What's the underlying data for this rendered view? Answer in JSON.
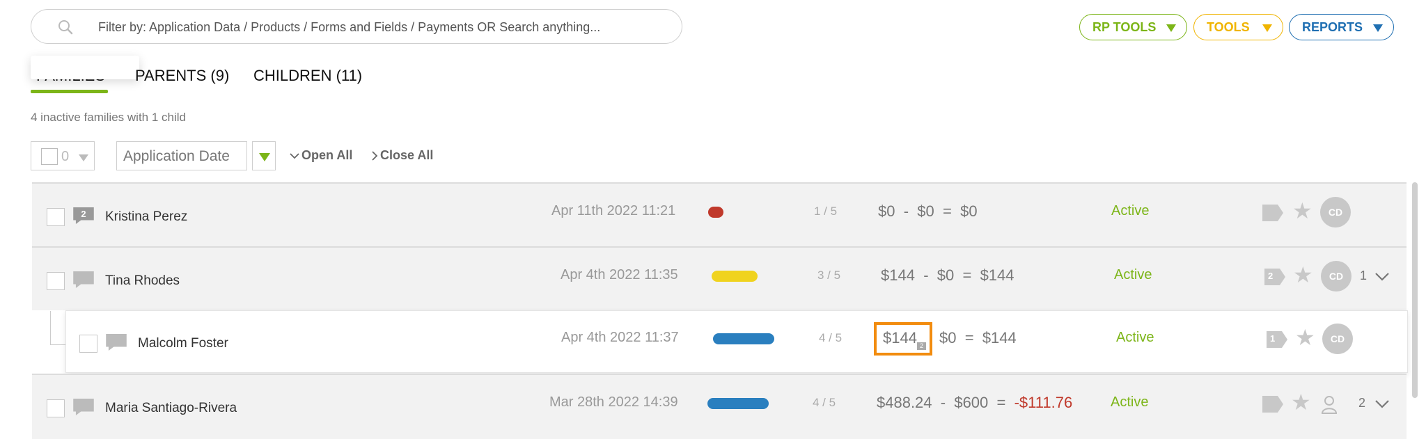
{
  "search": {
    "placeholder": "Filter by: Application Data / Products / Forms and Fields / Payments OR Search anything..."
  },
  "toolbar": {
    "rp_tools": "RP TOOLS",
    "tools": "TOOLS",
    "reports": "REPORTS"
  },
  "tabs": {
    "families": "FAMILIES",
    "parents": "PARENTS (9)",
    "children": "CHILDREN (11)"
  },
  "summary": "4 inactive families with 1 child",
  "filters": {
    "selected_count": "0",
    "sort_by": "Application Date",
    "open_all": "Open All",
    "close_all": "Close All"
  },
  "colors": {
    "accent_green": "#7cb518",
    "accent_yellow": "#f0b400",
    "accent_blue": "#1f6fb2",
    "highlight_orange": "#f28c0f",
    "negative_red": "#c0392b"
  },
  "rows": [
    {
      "name": "Kristina Perez",
      "message_count": "2",
      "date": "Apr 11th 2022 11:21",
      "progress": {
        "fraction": "1 / 5",
        "value": 0.2,
        "color": "#c0392b"
      },
      "charged": "$0",
      "paid": "$0",
      "balance": "$0",
      "status": "Active",
      "tag_count": "",
      "avatar": "CD",
      "child_count": ""
    },
    {
      "name": "Tina Rhodes",
      "message_count": "",
      "date": "Apr 4th 2022 11:35",
      "progress": {
        "fraction": "3 / 5",
        "value": 0.6,
        "color": "#f0d31e"
      },
      "charged": "$144",
      "paid": "$0",
      "balance": "$144",
      "status": "Active",
      "tag_count": "2",
      "avatar": "CD",
      "child_count": "1"
    },
    {
      "name": "Malcolm Foster",
      "message_count": "",
      "date": "Apr 4th 2022 11:37",
      "progress": {
        "fraction": "4 / 5",
        "value": 0.8,
        "color": "#2a7fbf"
      },
      "charged": "$144",
      "charged_badge": "2",
      "paid": "$0",
      "balance": "$144",
      "status": "Active",
      "tag_count": "1",
      "avatar": "CD",
      "child_count": ""
    },
    {
      "name": "Maria Santiago-Rivera",
      "message_count": "",
      "date": "Mar 28th 2022 14:39",
      "progress": {
        "fraction": "4 / 5",
        "value": 0.8,
        "color": "#2a7fbf"
      },
      "charged": "$488.24",
      "paid": "$600",
      "balance": "-$111.76",
      "status": "Active",
      "tag_count": "",
      "avatar": "",
      "child_count": "2"
    }
  ],
  "symbols": {
    "minus": "-",
    "equals": "="
  }
}
